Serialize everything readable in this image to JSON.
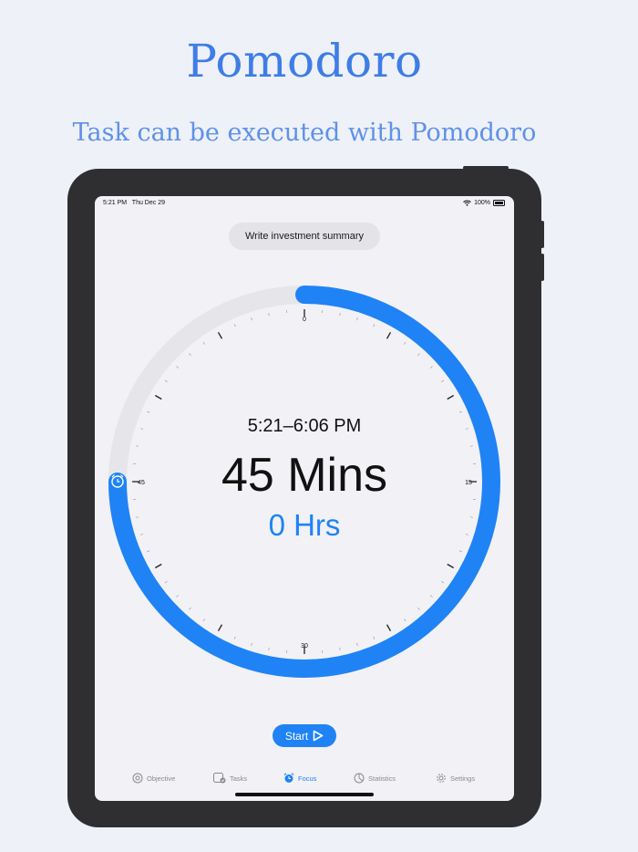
{
  "hero": {
    "title": "Pomodoro",
    "subtitle": "Task can be executed with  Pomodoro"
  },
  "status_bar": {
    "time": "5:21 PM",
    "date": "Thu Dec 29",
    "battery": "100%"
  },
  "task": {
    "name": "Write investment summary"
  },
  "timer": {
    "time_range": "5:21–6:06 PM",
    "minutes_label": "45 Mins",
    "hours_label": "0 Hrs",
    "progress_fraction": 0.75,
    "dial_labels": [
      "0",
      "15",
      "30",
      "45"
    ]
  },
  "start_button": {
    "label": "Start"
  },
  "tabs": [
    {
      "label": "Objective",
      "icon": "target-icon"
    },
    {
      "label": "Tasks",
      "icon": "tasks-icon"
    },
    {
      "label": "Focus",
      "icon": "alarm-clock-icon"
    },
    {
      "label": "Statistics",
      "icon": "pie-chart-icon"
    },
    {
      "label": "Settings",
      "icon": "gear-icon"
    }
  ],
  "colors": {
    "accent": "#1f83f5",
    "track": "#e6e6ea",
    "hero_title": "#3f7de6",
    "device": "#2f2f31"
  }
}
